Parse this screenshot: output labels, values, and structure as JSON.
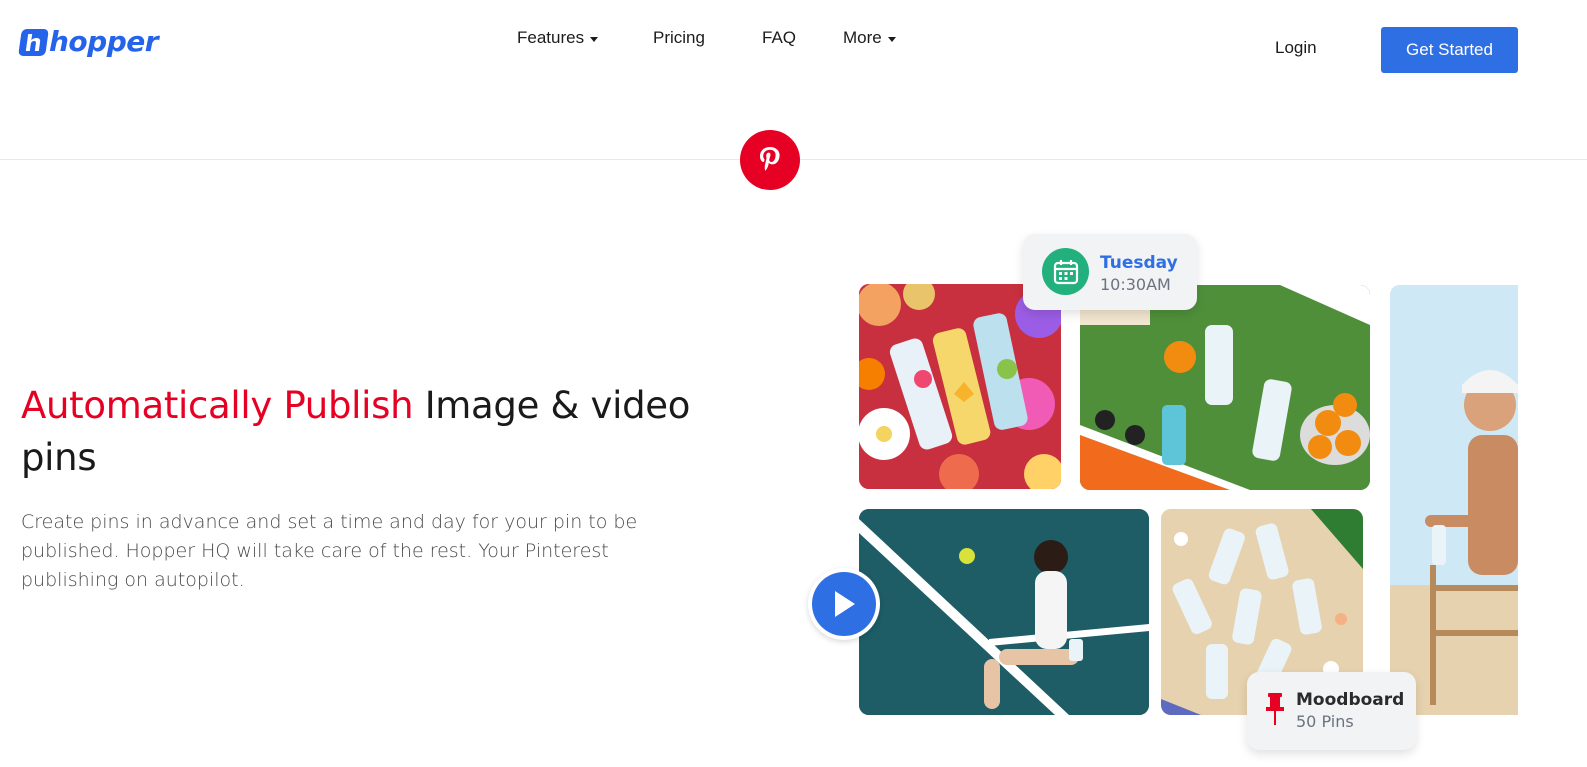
{
  "brand": {
    "name": "hopper",
    "logo_mark": "h",
    "color": "#2563eb"
  },
  "nav": {
    "items": [
      {
        "label": "Features",
        "has_dropdown": true
      },
      {
        "label": "Pricing",
        "has_dropdown": false
      },
      {
        "label": "FAQ",
        "has_dropdown": false
      },
      {
        "label": "More",
        "has_dropdown": true
      }
    ],
    "login_label": "Login",
    "cta_label": "Get Started",
    "cta_color": "#2f6fe4"
  },
  "network": {
    "icon": "pinterest-icon",
    "color": "#e60023"
  },
  "hero": {
    "title_accent": "Automatically Publish",
    "title_rest": " Image & video pins",
    "accent_color": "#e60023",
    "description": "Create pins in advance and set a time and day for your pin to be published. Hopper HQ will take care of the rest. Your Pinterest publishing on autopilot."
  },
  "collage": {
    "schedule_chip": {
      "icon": "calendar-icon",
      "day": "Tuesday",
      "time": "10:30AM",
      "icon_color": "#22b07d"
    },
    "board_chip": {
      "icon": "pushpin-icon",
      "name": "Moodboard",
      "count": "50 Pins",
      "icon_color": "#e60023"
    },
    "video_play_icon": "play-icon"
  }
}
